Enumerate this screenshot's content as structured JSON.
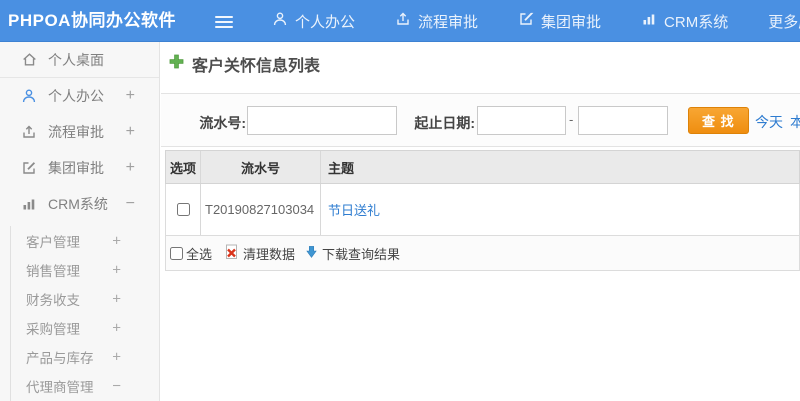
{
  "header": {
    "logo": "PHPOA协同办公软件",
    "nav": [
      {
        "label": "个人办公",
        "icon": "user-icon"
      },
      {
        "label": "流程审批",
        "icon": "upload-icon"
      },
      {
        "label": "集团审批",
        "icon": "edit-icon"
      },
      {
        "label": "CRM系统",
        "icon": "bar-chart-icon"
      },
      {
        "label": "更多应用",
        "icon": "caret-down-icon"
      }
    ]
  },
  "sidebar": {
    "items": [
      {
        "label": "个人桌面",
        "icon": "home-icon",
        "toggle": ""
      },
      {
        "label": "个人办公",
        "icon": "user-icon",
        "toggle": "+"
      },
      {
        "label": "流程审批",
        "icon": "upload-icon",
        "toggle": "+"
      },
      {
        "label": "集团审批",
        "icon": "edit-icon",
        "toggle": "+"
      },
      {
        "label": "CRM系统",
        "icon": "bar-chart-icon",
        "toggle": "−"
      }
    ],
    "subitems": [
      {
        "label": "客户管理",
        "toggle": "+"
      },
      {
        "label": "销售管理",
        "toggle": "+"
      },
      {
        "label": "财务收支",
        "toggle": "+"
      },
      {
        "label": "采购管理",
        "toggle": "+"
      },
      {
        "label": "产品与库存",
        "toggle": "+"
      },
      {
        "label": "代理商管理",
        "toggle": "−"
      }
    ]
  },
  "main": {
    "title": "客户关怀信息列表",
    "search": {
      "serial_label": "流水号:",
      "date_label": "起止日期:",
      "date_separator": "-",
      "search_button": "查 找",
      "today_link": "今天",
      "clipped_link": "本周"
    },
    "table": {
      "headers": [
        "选项",
        "流水号",
        "主题"
      ],
      "rows": [
        {
          "serial": "T20190827103034",
          "subject": "节日送礼"
        }
      ],
      "footer": {
        "select_all": "全选",
        "clear_data": "清理数据",
        "download": "下载查询结果"
      }
    }
  },
  "colors": {
    "header_blue": "#4a90e2",
    "button_orange": "#ef8e10",
    "link_blue": "#2e7cd0",
    "plus_green": "#62b152",
    "clear_red": "#d9331a",
    "download_arrow_blue": "#3f96d2"
  }
}
